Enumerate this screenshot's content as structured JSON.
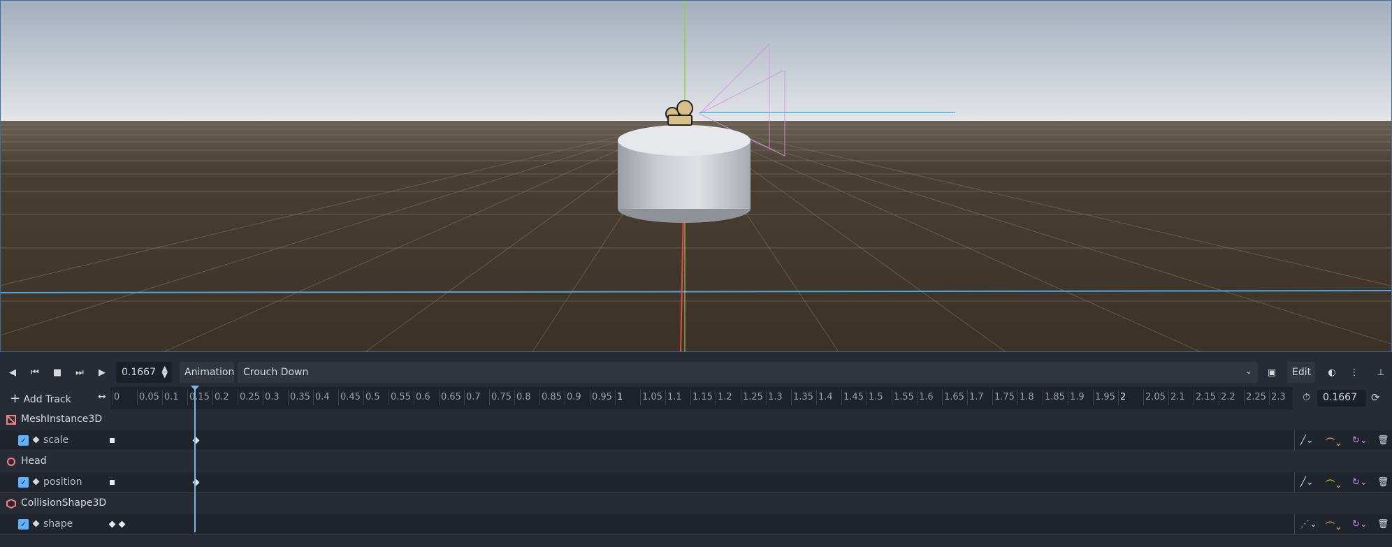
{
  "toolbar": {
    "time_value": "0.1667",
    "animation_label": "Animation",
    "animation_name": "Crouch Down",
    "edit_label": "Edit"
  },
  "timeline": {
    "add_track_label": "Add Track",
    "ticks": [
      "0",
      "0.05",
      "0.1",
      "0.15",
      "0.2",
      "0.25",
      "0.3",
      "0.35",
      "0.4",
      "0.45",
      "0.5",
      "0.55",
      "0.6",
      "0.65",
      "0.7",
      "0.75",
      "0.8",
      "0.85",
      "0.9",
      "0.95",
      "1",
      "1.05",
      "1.1",
      "1.15",
      "1.2",
      "1.25",
      "1.3",
      "1.35",
      "1.4",
      "1.45",
      "1.5",
      "1.55",
      "1.6",
      "1.65",
      "1.7",
      "1.75",
      "1.8",
      "1.85",
      "1.9",
      "1.95",
      "2",
      "2.05",
      "2.1",
      "2.15",
      "2.2",
      "2.25",
      "2.3"
    ],
    "major_ticks": [
      "1",
      "2"
    ],
    "length_value": "0.1667"
  },
  "tracks": [
    {
      "node": "MeshInstance3D",
      "node_icon": "mesh-instance-icon",
      "property": "scale",
      "interp": "linear",
      "keys": [
        0,
        0.1667
      ]
    },
    {
      "node": "Head",
      "node_icon": "node3d-icon",
      "property": "position",
      "interp": "linear",
      "keys": [
        0,
        0.1667
      ]
    },
    {
      "node": "CollisionShape3D",
      "node_icon": "collision-shape-icon",
      "property": "shape",
      "interp": "discrete",
      "keys": [
        0,
        0.02
      ]
    }
  ],
  "colors": {
    "accent": "#5fb2ff",
    "playhead": "#7ab7e8",
    "node_icon": "#fc7f7f",
    "interp_yellow": "#f5c542",
    "loop_purple": "#c68cff"
  }
}
